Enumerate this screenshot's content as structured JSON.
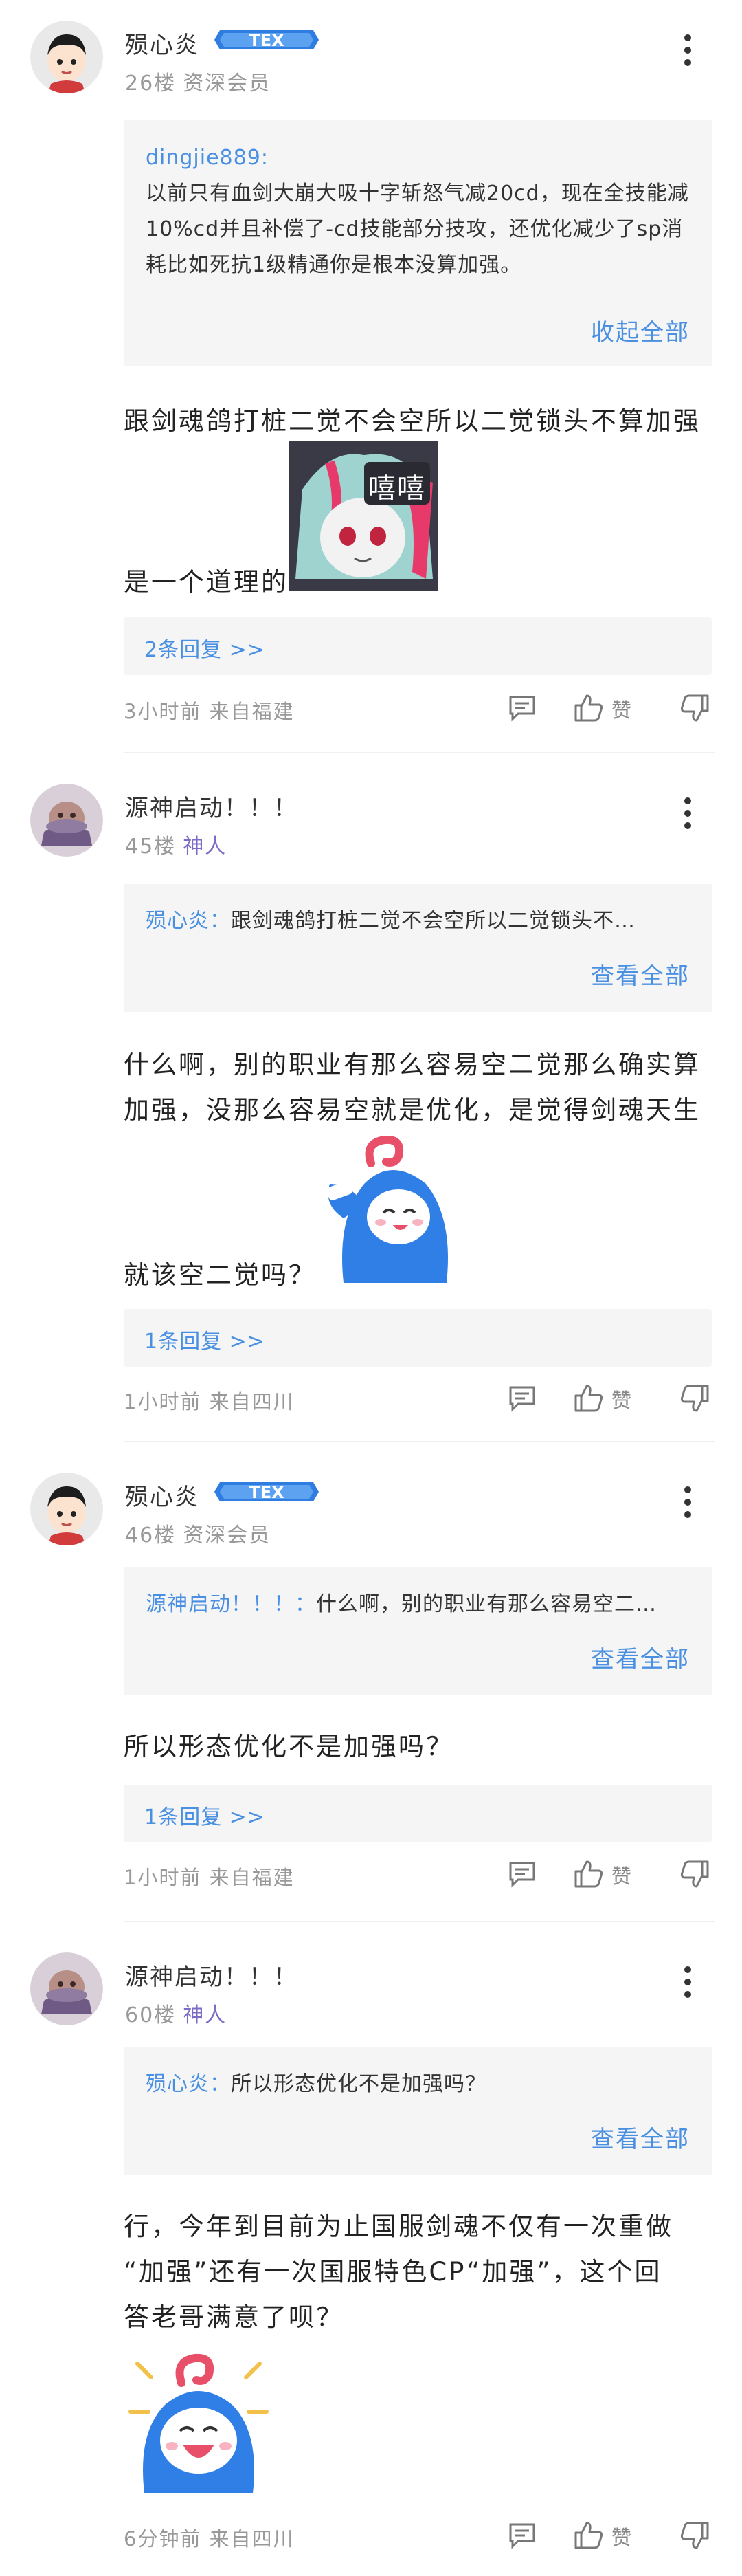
{
  "posts": [
    {
      "username": "殒心炎",
      "floor": "26楼",
      "level": "资深会员",
      "quote_name": "dingjie889:",
      "quote_text": "以前只有血剑大崩大吸十字斩怒气减20cd，现在全技能减10%cd并且补偿了-cd技能部分技攻，还优化减少了sp消耗比如死抗1级精通你是根本没算加强。",
      "quote_action": "收起全部",
      "body_line1": "跟剑魂鸽打桩二觉不会空所以二觉锁头不算加强",
      "body_line2": "是一个道理的",
      "sticker_label": "嘻嘻",
      "replies": "2条回复 >>",
      "time_location": "3小时前 来自福建",
      "like_label": "赞"
    },
    {
      "username": "源神启动！！！",
      "floor": "45楼",
      "level": "神人",
      "quote_name": "殒心炎：",
      "quote_text": "跟剑魂鸽打桩二觉不会空所以二觉锁头不…",
      "quote_action": "查看全部",
      "body_line1": "什么啊，别的职业有那么容易空二觉那么确实算",
      "body_line2": "加强，没那么容易空就是优化，是觉得剑魂天生",
      "body_line3": "就该空二觉吗？",
      "replies": "1条回复 >>",
      "time_location": "1小时前 来自四川",
      "like_label": "赞"
    },
    {
      "username": "殒心炎",
      "floor": "46楼",
      "level": "资深会员",
      "quote_name": "源神启动！！！：",
      "quote_text": "什么啊，别的职业有那么容易空二…",
      "quote_action": "查看全部",
      "body_line1": "所以形态优化不是加强吗？",
      "replies": "1条回复 >>",
      "time_location": "1小时前 来自福建",
      "like_label": "赞"
    },
    {
      "username": "源神启动！！！",
      "floor": "60楼",
      "level": "神人",
      "quote_name": "殒心炎：",
      "quote_text": "所以形态优化不是加强吗？",
      "quote_action": "查看全部",
      "body_line1": "行，今年到目前为止国服剑魂不仅有一次重做",
      "body_line2": "“加强”还有一次国服特色CP“加强”，这个回",
      "body_line3": "答老哥满意了呗？",
      "time_location": "6分钟前 来自四川",
      "like_label": "赞"
    }
  ],
  "colors": {
    "link": "#4a90e2",
    "level_purple": "#7c6cc8",
    "quote_bg": "#f5f5f5",
    "meta": "#999999"
  },
  "icons": [
    "more-dots-icon",
    "comment-icon",
    "thumbs-up-icon",
    "thumbs-down-icon",
    "member-badge-icon"
  ]
}
